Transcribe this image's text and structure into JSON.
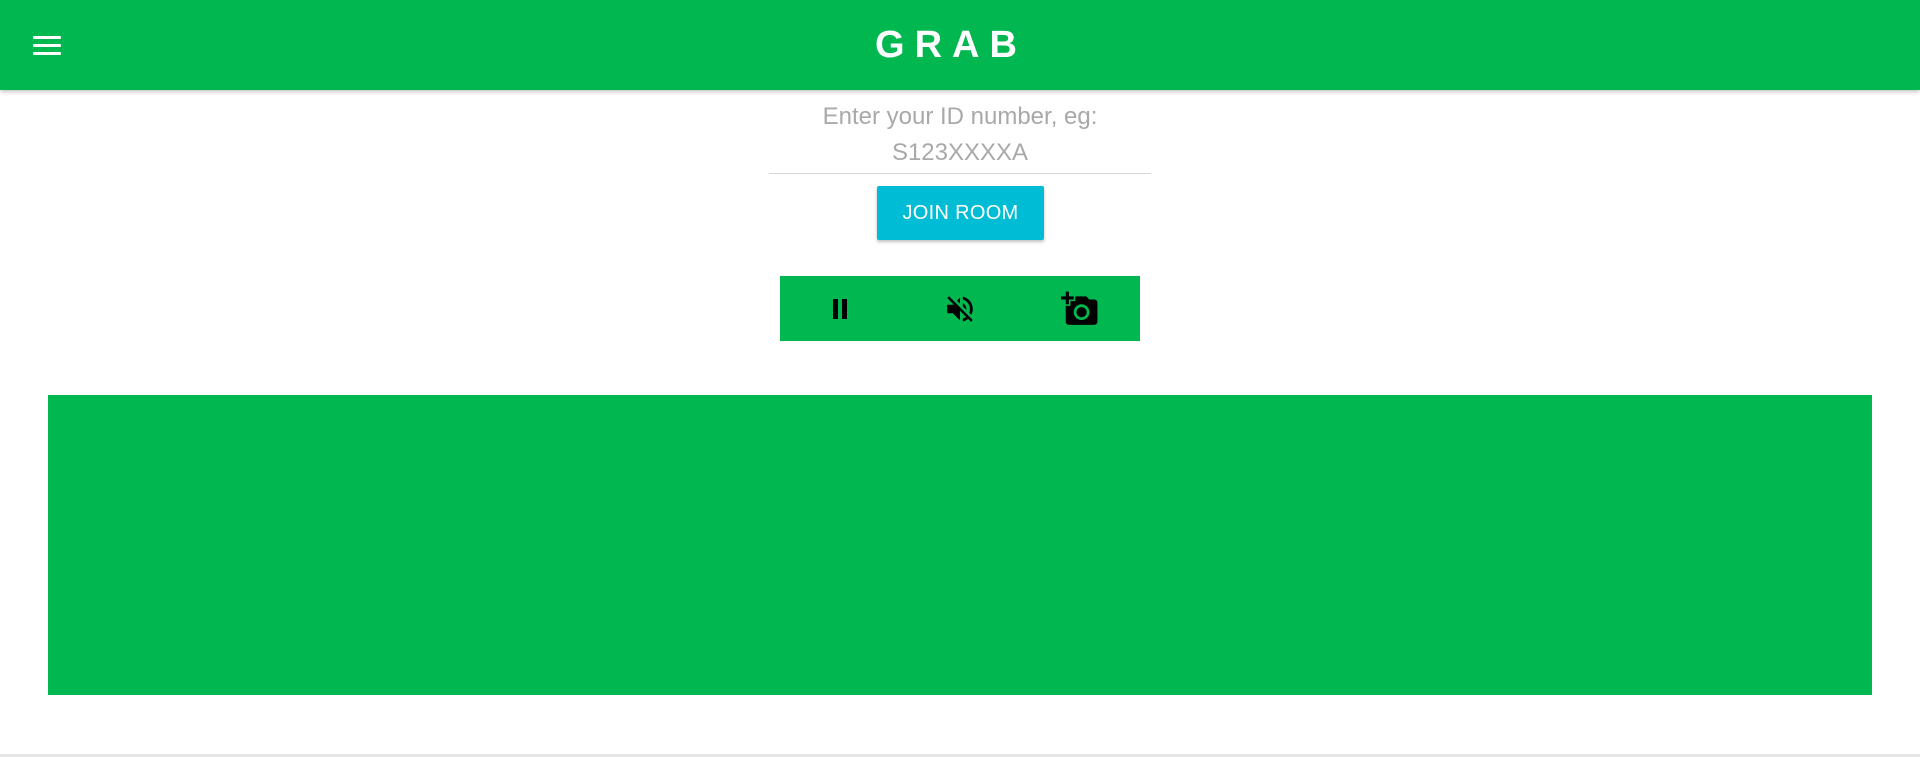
{
  "header": {
    "title": "GRAB",
    "menu_icon": "hamburger-menu-icon"
  },
  "id_input": {
    "value": "",
    "placeholder": "Enter your ID number, eg: S123XXXXA"
  },
  "join_button": {
    "label": "JOIN ROOM"
  },
  "controls": {
    "items": [
      {
        "icon": "pause-icon"
      },
      {
        "icon": "volume-off-icon"
      },
      {
        "icon": "add-photo-icon"
      }
    ]
  },
  "colors": {
    "brand_green": "#00b84f",
    "button_cyan": "#00bcd4",
    "placeholder_gray": "#a9a9a9"
  }
}
